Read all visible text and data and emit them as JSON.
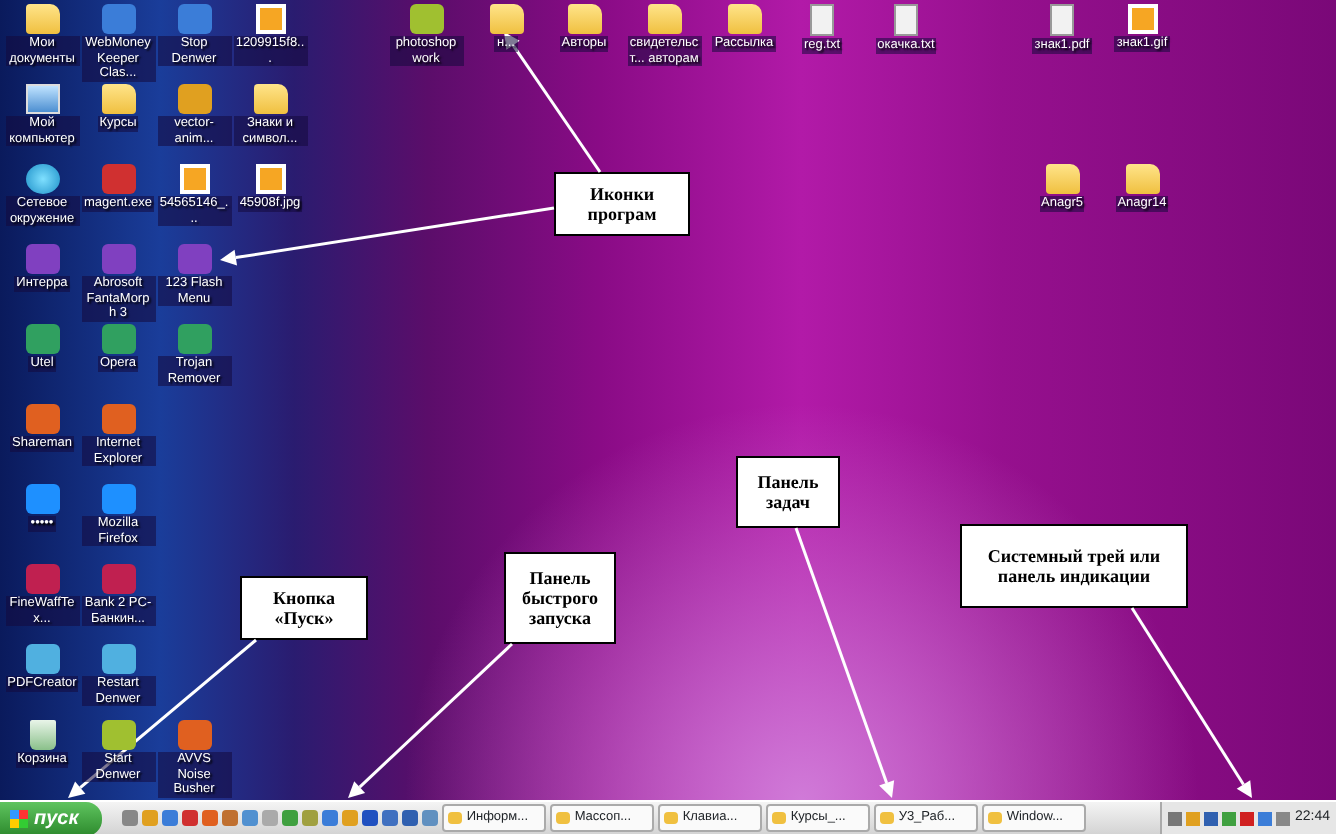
{
  "desktop_icons": [
    {
      "label": "Мои документы",
      "kind": "folder"
    },
    {
      "label": "Мой компьютер",
      "kind": "computer"
    },
    {
      "label": "Сетевое окружение",
      "kind": "network"
    },
    {
      "label": "Интерра",
      "kind": "app"
    },
    {
      "label": "Utel",
      "kind": "app"
    },
    {
      "label": "Shareman",
      "kind": "app"
    },
    {
      "label": "•••••",
      "kind": "app"
    },
    {
      "label": "FineWaffTex...",
      "kind": "app"
    },
    {
      "label": "PDFCreator",
      "kind": "app"
    },
    {
      "label": "Корзина",
      "kind": "trash"
    },
    {
      "label": "WebMoney Keeper Clas...",
      "kind": "app"
    },
    {
      "label": "Курсы",
      "kind": "folder"
    },
    {
      "label": "magent.exe",
      "kind": "app"
    },
    {
      "label": "Abrosoft FantaMorph 3",
      "kind": "app"
    },
    {
      "label": "Opera",
      "kind": "app"
    },
    {
      "label": "Internet Explorer",
      "kind": "app"
    },
    {
      "label": "Mozilla Firefox",
      "kind": "app"
    },
    {
      "label": "Bank 2 PC-Банкин...",
      "kind": "app"
    },
    {
      "label": "Restart Denwer",
      "kind": "app"
    },
    {
      "label": "Start Denwer",
      "kind": "app"
    },
    {
      "label": "Stop Denwer",
      "kind": "app"
    },
    {
      "label": "vector-anim...",
      "kind": "app"
    },
    {
      "label": "54565146_...",
      "kind": "image"
    },
    {
      "label": "123 Flash Menu",
      "kind": "app"
    },
    {
      "label": "Trojan Remover",
      "kind": "app"
    },
    {
      "label": "AVVS Noise Busher",
      "kind": "app"
    },
    {
      "label": "1209915f8...",
      "kind": "image"
    },
    {
      "label": "Знаки и символ...",
      "kind": "folder"
    },
    {
      "label": "45908f.jpg",
      "kind": "image"
    },
    {
      "label": "photoshop work",
      "kind": "app"
    },
    {
      "label": "н...",
      "kind": "folder"
    },
    {
      "label": "Авторы",
      "kind": "folder"
    },
    {
      "label": "свидетельст... авторам",
      "kind": "folder"
    },
    {
      "label": "Рассылка",
      "kind": "folder"
    },
    {
      "label": "reg.txt",
      "kind": "document"
    },
    {
      "label": "окачка.txt",
      "kind": "document"
    },
    {
      "label": "знак1.pdf",
      "kind": "document"
    },
    {
      "label": "знак1.gif",
      "kind": "image"
    },
    {
      "label": "Anagr5",
      "kind": "folder"
    },
    {
      "label": "Anagr14",
      "kind": "folder"
    }
  ],
  "callouts": [
    {
      "text": "Иконки програм"
    },
    {
      "text": "Кнопка «Пуск»"
    },
    {
      "text": "Панель быстрого запуска"
    },
    {
      "text": "Панель задач"
    },
    {
      "text": "Системный трей или панель индикации"
    }
  ],
  "taskbar": {
    "start_label": "пуск",
    "task_buttons": [
      {
        "label": "Информ..."
      },
      {
        "label": "Массоп..."
      },
      {
        "label": "Клавиа..."
      },
      {
        "label": "Курсы_..."
      },
      {
        "label": "У3_Раб..."
      },
      {
        "label": "Window..."
      }
    ],
    "clock": "22:44"
  }
}
